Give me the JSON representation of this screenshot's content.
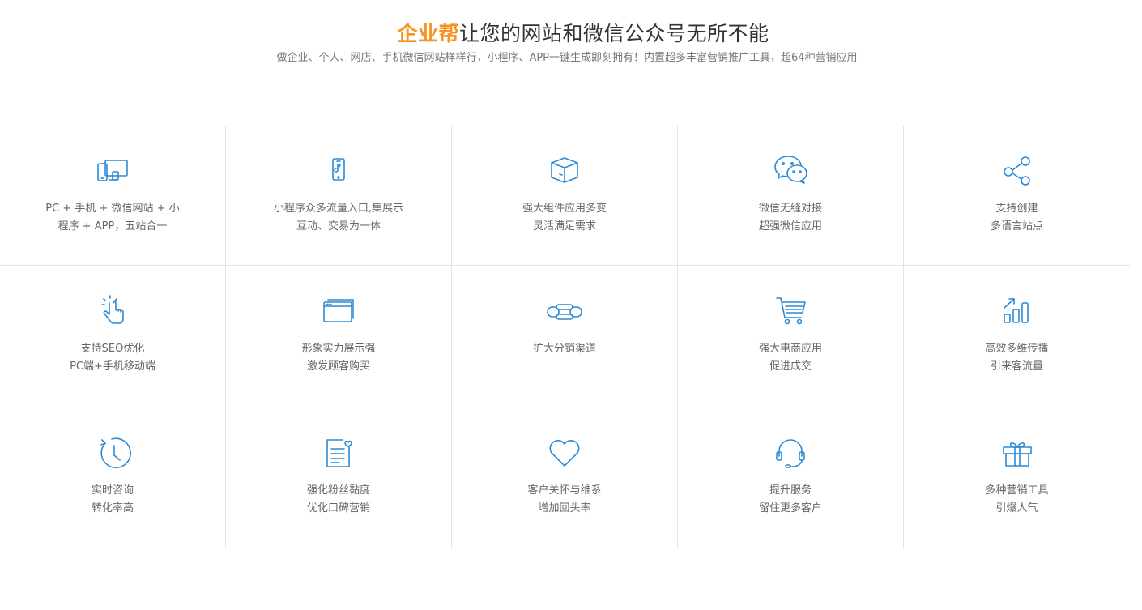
{
  "heading": {
    "brand": "企业帮",
    "rest": "让您的网站和微信公众号无所不能"
  },
  "subheading": "做企业、个人、网店、手机微信网站样样行，小程序、APP一键生成即刻拥有！内置超多丰富营销推广工具，超64种营销应用",
  "theme": {
    "icon_color": "#2b8ad6",
    "brand_color": "#f7931e",
    "divider_color": "#e3e3e3"
  },
  "features": [
    {
      "icon": "devices-icon",
      "line1": "PC + 手机 + 微信网站 + 小",
      "line2": "程序 + APP，五站合一"
    },
    {
      "icon": "mini-program-phone-icon",
      "line1": "小程序众多流量入口,集展示",
      "line2": "互动、交易为一体"
    },
    {
      "icon": "box-icon",
      "line1": "强大组件应用多变",
      "line2": "灵活满足需求"
    },
    {
      "icon": "wechat-icon",
      "line1": "微信无缝对接",
      "line2": "超强微信应用"
    },
    {
      "icon": "share-icon",
      "line1": "支持创建",
      "line2": "多语言站点"
    },
    {
      "icon": "click-hand-icon",
      "line1": "支持SEO优化",
      "line2": "PC端+手机移动端"
    },
    {
      "icon": "browser-windows-icon",
      "line1": "形象实力展示强",
      "line2": "激发顾客购买"
    },
    {
      "icon": "chain-link-icon",
      "line1": "扩大分销渠道",
      "line2": ""
    },
    {
      "icon": "shopping-cart-icon",
      "line1": "强大电商应用",
      "line2": "促进成交"
    },
    {
      "icon": "growth-chart-icon",
      "line1": "高效多维传播",
      "line2": "引来客流量"
    },
    {
      "icon": "clock-icon",
      "line1": "实时咨询",
      "line2": "转化率高"
    },
    {
      "icon": "document-heart-icon",
      "line1": "强化粉丝黏度",
      "line2": "优化口碑营销"
    },
    {
      "icon": "heart-icon",
      "line1": "客户关怀与维系",
      "line2": "增加回头率"
    },
    {
      "icon": "headset-icon",
      "line1": "提升服务",
      "line2": "留住更多客户"
    },
    {
      "icon": "gift-icon",
      "line1": "多种营销工具",
      "line2": "引爆人气"
    }
  ]
}
